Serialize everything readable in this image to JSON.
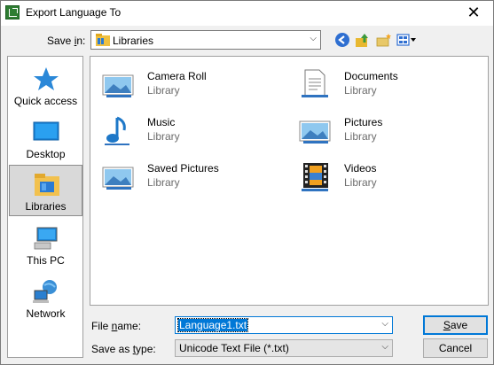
{
  "window": {
    "title": "Export Language To",
    "close_glyph": "✕"
  },
  "save_in": {
    "label_prefix": "Save ",
    "label_key": "i",
    "label_suffix": "n:",
    "value": "Libraries",
    "icon": "libraries-icon"
  },
  "toolbar": {
    "icons": [
      "back-icon",
      "up-folder-icon",
      "new-folder-icon",
      "view-menu-icon"
    ]
  },
  "places": [
    {
      "label": "Quick access",
      "icon": "star-icon"
    },
    {
      "label": "Desktop",
      "icon": "desktop-icon"
    },
    {
      "label": "Libraries",
      "icon": "libraries-icon",
      "selected": true
    },
    {
      "label": "This PC",
      "icon": "computer-icon"
    },
    {
      "label": "Network",
      "icon": "network-icon"
    }
  ],
  "items": [
    {
      "name": "Camera Roll",
      "type": "Library",
      "icon": "picture-library-icon"
    },
    {
      "name": "Documents",
      "type": "Library",
      "icon": "documents-icon"
    },
    {
      "name": "Music",
      "type": "Library",
      "icon": "music-icon"
    },
    {
      "name": "Pictures",
      "type": "Library",
      "icon": "picture-library-icon"
    },
    {
      "name": "Saved Pictures",
      "type": "Library",
      "icon": "picture-library-icon"
    },
    {
      "name": "Videos",
      "type": "Library",
      "icon": "videos-icon"
    }
  ],
  "file_name": {
    "label_prefix": "File ",
    "label_key": "n",
    "label_suffix": "ame:",
    "value": "Language1.txt"
  },
  "save_as_type": {
    "label_prefix": "Save as ",
    "label_key": "t",
    "label_suffix": "ype:",
    "value": "Unicode Text File (*.txt)"
  },
  "buttons": {
    "save_key": "S",
    "save_rest": "ave",
    "cancel": "Cancel"
  },
  "colors": {
    "accent": "#0078d7",
    "selection": "#d9d9d9"
  }
}
